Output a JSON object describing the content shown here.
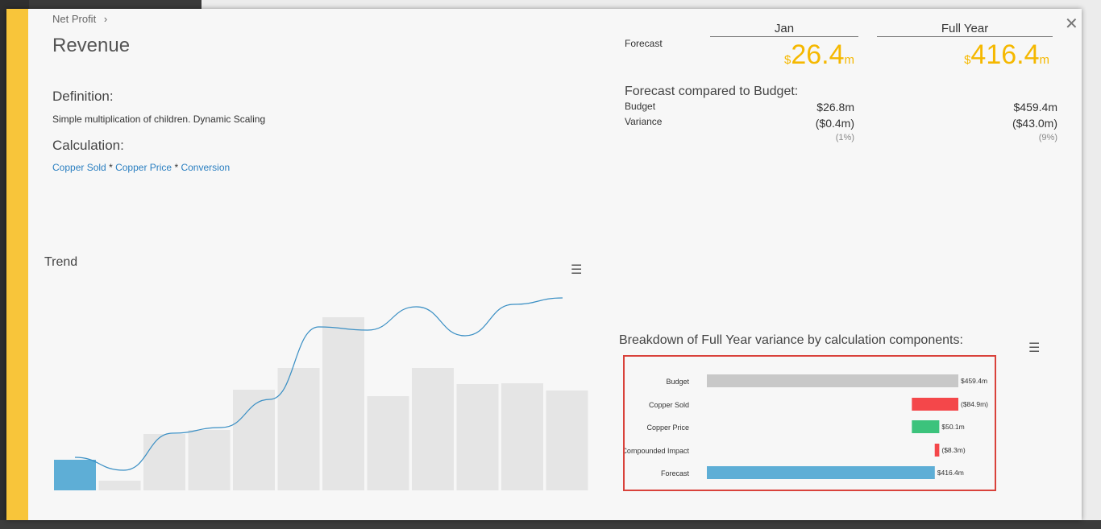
{
  "modal": {
    "breadcrumb": "Net Profit",
    "breadcrumb_icon": "chevron-right-icon",
    "title": "Revenue",
    "definition_heading": "Definition:",
    "definition_text": "Simple multiplication of children. Dynamic Scaling",
    "calculation_heading": "Calculation:",
    "calc_terms": [
      "Copper Sold",
      "Copper Price",
      "Conversion"
    ],
    "calc_operator": "*",
    "close_icon": "close-icon",
    "accent_color": "#f8c53a"
  },
  "kpi": {
    "columns": [
      "Jan",
      "Full Year"
    ],
    "forecast_label": "Forecast",
    "forecast": [
      {
        "currency": "$",
        "value": "26.4",
        "unit": "m"
      },
      {
        "currency": "$",
        "value": "416.4",
        "unit": "m"
      }
    ],
    "forecast_color": "#f5b800",
    "compare_title": "Forecast compared to Budget:",
    "budget_label": "Budget",
    "variance_label": "Variance",
    "budget": [
      "$26.8m",
      "$459.4m"
    ],
    "variance": [
      "($0.4m)",
      "($43.0m)"
    ],
    "variance_pct": [
      "(1%)",
      "(9%)"
    ]
  },
  "trend": {
    "label": "Trend",
    "menu_icon": "hamburger-menu-icon",
    "chart_data": {
      "type": "bar+line",
      "bars": [
        38,
        12,
        70,
        75,
        125,
        152,
        215,
        117,
        152,
        132,
        133,
        124
      ],
      "highlight_index": 0,
      "line": [
        41,
        25,
        71,
        78,
        113,
        203,
        199,
        228,
        192,
        231,
        239
      ],
      "bar_color": "#e5e5e5",
      "highlight_color": "#5eaed6",
      "line_color": "#3a8fc4"
    }
  },
  "breakdown": {
    "title": "Breakdown of Full Year variance by calculation components:",
    "menu_icon": "hamburger-menu-icon",
    "chart_data": {
      "type": "bar",
      "categories": [
        "Budget",
        "Copper Sold",
        "Copper Price",
        "Compounded Impact",
        "Forecast"
      ],
      "values": [
        459.4,
        -84.9,
        50.1,
        -8.3,
        416.4
      ],
      "labels": [
        "$459.4m",
        "($84.9m)",
        "$50.1m",
        "($8.3m)",
        "$416.4m"
      ],
      "colors": [
        "#c8c8c8",
        "#f4474a",
        "#3cc37c",
        "#f4474a",
        "#5eaed6"
      ]
    }
  }
}
